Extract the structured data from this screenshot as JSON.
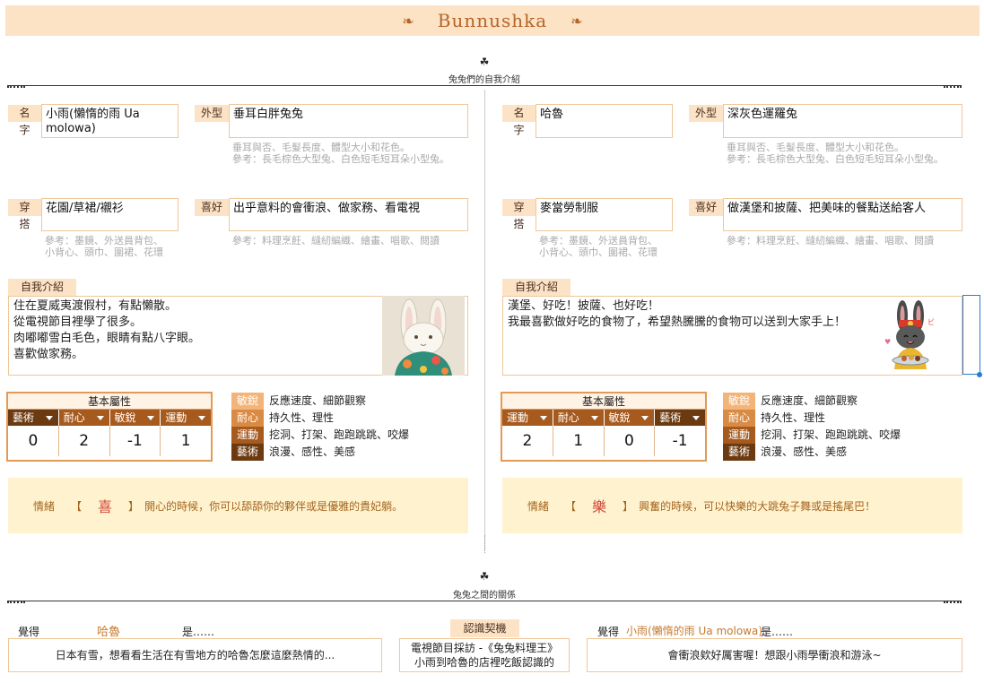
{
  "banner": {
    "title": "Bunnushka",
    "left_ornament": "❧",
    "right_ornament": "❧"
  },
  "sections": {
    "intro": {
      "icon": "☘",
      "label": "兔兔們的自我介紹"
    },
    "relation": {
      "icon": "☘",
      "label": "兔兔之間的關係"
    }
  },
  "labels": {
    "name": "名字",
    "appearance": "外型",
    "outfit": "穿搭",
    "hobby": "喜好",
    "intro": "自我介紹",
    "appearance_hint": "垂耳與否、毛髮長度、體型大小和花色。\n參考：長毛棕色大型兔、白色短毛短耳朵小型兔。",
    "outfit_hint": "參考：墨鏡、外送員背包、\n小背心、頭巾、圍裙、花環",
    "hobby_hint": "參考：料理烹飪、縫紉編織、繪畫、唱歌、閱讀",
    "stats_title": "基本屬性",
    "emotion_label": "情緒",
    "bracket_open": "【",
    "bracket_close": "】"
  },
  "attr_legend": [
    {
      "tag": "敏銳",
      "desc": "反應速度、細節觀察"
    },
    {
      "tag": "耐心",
      "desc": "持久性、理性"
    },
    {
      "tag": "運動",
      "desc": "挖洞、打架、跑跑跳跳、咬爆"
    },
    {
      "tag": "藝術",
      "desc": "浪漫、感性、美感"
    }
  ],
  "left": {
    "name": "小雨(懶惰的雨 Ua molowa)",
    "appearance": "垂耳白胖兔兔",
    "outfit": "花園/草裙/襯衫",
    "hobby": "出乎意料的會衝浪、做家務、看電視",
    "intro_text": "住在夏威夷渡假村，有點懶散。\n從電視節目裡學了很多。\n肉嘟嘟雪白毛色，眼睛有點八字眼。\n喜歡做家務。",
    "stat_cols": [
      "藝術",
      "耐心",
      "敏銳",
      "運動"
    ],
    "stat_vals": [
      "0",
      "2",
      "-1",
      "1"
    ],
    "emotion_char": "喜",
    "emotion_text": "開心的時候，你可以舔舔你的夥伴或是優雅的貴妃躺。"
  },
  "right": {
    "name": "哈魯",
    "appearance": "深灰色運羅兔",
    "outfit": "麥當勞制服",
    "hobby": "做漢堡和披薩、把美味的餐點送給客人",
    "intro_text": "漢堡、好吃！披薩、也好吃！\n我最喜歡做好吃的食物了，希望熱騰騰的食物可以送到大家手上！",
    "stat_cols": [
      "運動",
      "耐心",
      "敏銳",
      "藝術"
    ],
    "stat_vals": [
      "2",
      "1",
      "0",
      "-1"
    ],
    "emotion_char": "樂",
    "emotion_text": "興奮的時候，可以快樂的大跳兔子舞或是搖尾巴！"
  },
  "relation": {
    "left_prefix": "覺得",
    "left_name": "哈魯",
    "left_suffix": "是……",
    "left_text": "日本有雪，想看看生活在有雪地方的哈魯怎麼這麼熱情的...",
    "meet_label": "認識契機",
    "meet_text": "電視節目採訪 -《兔兔料理王》\n小雨到哈魯的店裡吃飯認識的",
    "right_prefix": "覺得",
    "right_name": "小雨(懶惰的雨 Ua molowa)",
    "right_suffix": "是……",
    "right_text": "會衝浪欸好厲害喔！想跟小雨學衝浪和游泳~"
  },
  "colors": {
    "accent": "#b5652a",
    "tag_bg": "#fce3c6",
    "border": "#f0c698",
    "stat_dark": "#6b3a10",
    "stat_mid": "#a75a1d",
    "emotion_bg": "#fff3cf"
  }
}
